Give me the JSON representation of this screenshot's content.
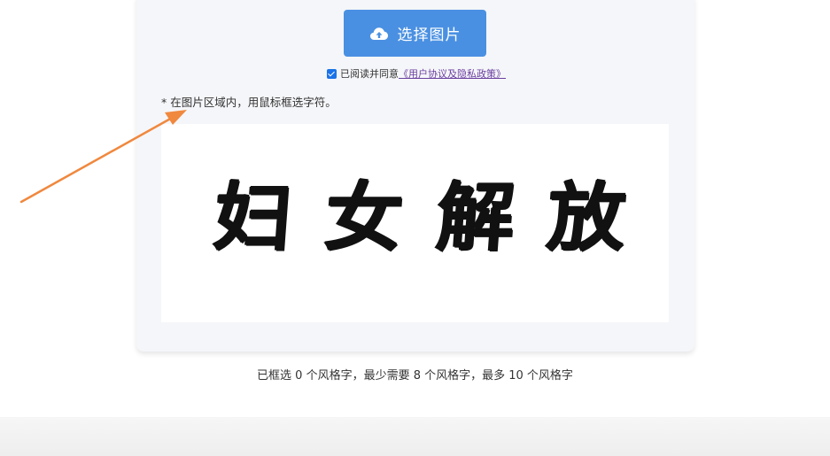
{
  "upload": {
    "label": "选择图片",
    "icon": "cloud-upload-icon",
    "color": "#4a90e2"
  },
  "agreement": {
    "checked": true,
    "prefix": "已阅读并同意",
    "link": "《用户协议及隐私政策》"
  },
  "hint": "* 在图片区域内，用鼠标框选字符。",
  "image": {
    "characters": [
      "妇",
      "女",
      "解",
      "放"
    ]
  },
  "status": "已框选 0 个风格字，最少需要 8 个风格字，最多 10 个风格字",
  "arrow": {
    "color": "#f0883e"
  }
}
